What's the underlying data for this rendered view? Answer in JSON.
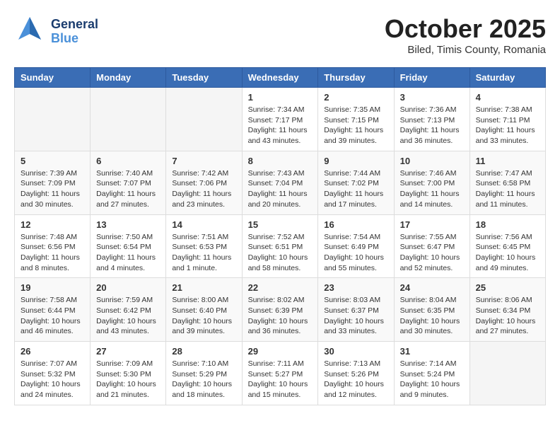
{
  "header": {
    "logo": {
      "line1": "General",
      "line2": "Blue"
    },
    "title": "October 2025",
    "subtitle": "Biled, Timis County, Romania"
  },
  "calendar": {
    "days_of_week": [
      "Sunday",
      "Monday",
      "Tuesday",
      "Wednesday",
      "Thursday",
      "Friday",
      "Saturday"
    ],
    "weeks": [
      [
        {
          "day": "",
          "info": ""
        },
        {
          "day": "",
          "info": ""
        },
        {
          "day": "",
          "info": ""
        },
        {
          "day": "1",
          "info": "Sunrise: 7:34 AM\nSunset: 7:17 PM\nDaylight: 11 hours\nand 43 minutes."
        },
        {
          "day": "2",
          "info": "Sunrise: 7:35 AM\nSunset: 7:15 PM\nDaylight: 11 hours\nand 39 minutes."
        },
        {
          "day": "3",
          "info": "Sunrise: 7:36 AM\nSunset: 7:13 PM\nDaylight: 11 hours\nand 36 minutes."
        },
        {
          "day": "4",
          "info": "Sunrise: 7:38 AM\nSunset: 7:11 PM\nDaylight: 11 hours\nand 33 minutes."
        }
      ],
      [
        {
          "day": "5",
          "info": "Sunrise: 7:39 AM\nSunset: 7:09 PM\nDaylight: 11 hours\nand 30 minutes."
        },
        {
          "day": "6",
          "info": "Sunrise: 7:40 AM\nSunset: 7:07 PM\nDaylight: 11 hours\nand 27 minutes."
        },
        {
          "day": "7",
          "info": "Sunrise: 7:42 AM\nSunset: 7:06 PM\nDaylight: 11 hours\nand 23 minutes."
        },
        {
          "day": "8",
          "info": "Sunrise: 7:43 AM\nSunset: 7:04 PM\nDaylight: 11 hours\nand 20 minutes."
        },
        {
          "day": "9",
          "info": "Sunrise: 7:44 AM\nSunset: 7:02 PM\nDaylight: 11 hours\nand 17 minutes."
        },
        {
          "day": "10",
          "info": "Sunrise: 7:46 AM\nSunset: 7:00 PM\nDaylight: 11 hours\nand 14 minutes."
        },
        {
          "day": "11",
          "info": "Sunrise: 7:47 AM\nSunset: 6:58 PM\nDaylight: 11 hours\nand 11 minutes."
        }
      ],
      [
        {
          "day": "12",
          "info": "Sunrise: 7:48 AM\nSunset: 6:56 PM\nDaylight: 11 hours\nand 8 minutes."
        },
        {
          "day": "13",
          "info": "Sunrise: 7:50 AM\nSunset: 6:54 PM\nDaylight: 11 hours\nand 4 minutes."
        },
        {
          "day": "14",
          "info": "Sunrise: 7:51 AM\nSunset: 6:53 PM\nDaylight: 11 hours\nand 1 minute."
        },
        {
          "day": "15",
          "info": "Sunrise: 7:52 AM\nSunset: 6:51 PM\nDaylight: 10 hours\nand 58 minutes."
        },
        {
          "day": "16",
          "info": "Sunrise: 7:54 AM\nSunset: 6:49 PM\nDaylight: 10 hours\nand 55 minutes."
        },
        {
          "day": "17",
          "info": "Sunrise: 7:55 AM\nSunset: 6:47 PM\nDaylight: 10 hours\nand 52 minutes."
        },
        {
          "day": "18",
          "info": "Sunrise: 7:56 AM\nSunset: 6:45 PM\nDaylight: 10 hours\nand 49 minutes."
        }
      ],
      [
        {
          "day": "19",
          "info": "Sunrise: 7:58 AM\nSunset: 6:44 PM\nDaylight: 10 hours\nand 46 minutes."
        },
        {
          "day": "20",
          "info": "Sunrise: 7:59 AM\nSunset: 6:42 PM\nDaylight: 10 hours\nand 43 minutes."
        },
        {
          "day": "21",
          "info": "Sunrise: 8:00 AM\nSunset: 6:40 PM\nDaylight: 10 hours\nand 39 minutes."
        },
        {
          "day": "22",
          "info": "Sunrise: 8:02 AM\nSunset: 6:39 PM\nDaylight: 10 hours\nand 36 minutes."
        },
        {
          "day": "23",
          "info": "Sunrise: 8:03 AM\nSunset: 6:37 PM\nDaylight: 10 hours\nand 33 minutes."
        },
        {
          "day": "24",
          "info": "Sunrise: 8:04 AM\nSunset: 6:35 PM\nDaylight: 10 hours\nand 30 minutes."
        },
        {
          "day": "25",
          "info": "Sunrise: 8:06 AM\nSunset: 6:34 PM\nDaylight: 10 hours\nand 27 minutes."
        }
      ],
      [
        {
          "day": "26",
          "info": "Sunrise: 7:07 AM\nSunset: 5:32 PM\nDaylight: 10 hours\nand 24 minutes."
        },
        {
          "day": "27",
          "info": "Sunrise: 7:09 AM\nSunset: 5:30 PM\nDaylight: 10 hours\nand 21 minutes."
        },
        {
          "day": "28",
          "info": "Sunrise: 7:10 AM\nSunset: 5:29 PM\nDaylight: 10 hours\nand 18 minutes."
        },
        {
          "day": "29",
          "info": "Sunrise: 7:11 AM\nSunset: 5:27 PM\nDaylight: 10 hours\nand 15 minutes."
        },
        {
          "day": "30",
          "info": "Sunrise: 7:13 AM\nSunset: 5:26 PM\nDaylight: 10 hours\nand 12 minutes."
        },
        {
          "day": "31",
          "info": "Sunrise: 7:14 AM\nSunset: 5:24 PM\nDaylight: 10 hours\nand 9 minutes."
        },
        {
          "day": "",
          "info": ""
        }
      ]
    ]
  }
}
